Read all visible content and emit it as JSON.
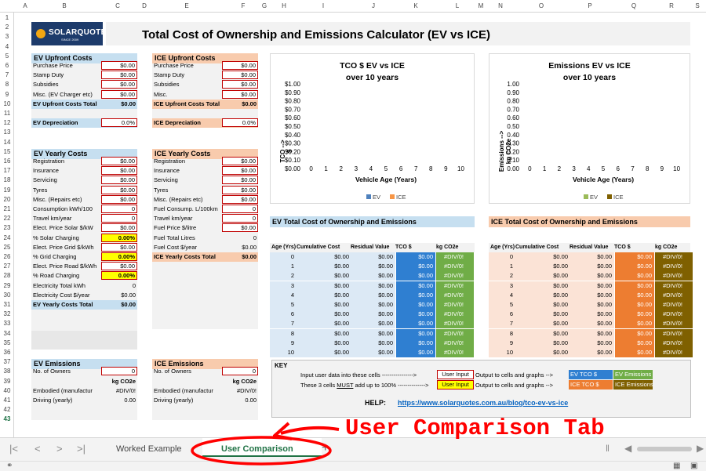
{
  "column_headers": [
    "A",
    "B",
    "C",
    "D",
    "E",
    "F",
    "G",
    "H",
    "I",
    "J",
    "K",
    "L",
    "M",
    "N",
    "O",
    "P",
    "Q",
    "R",
    "S"
  ],
  "row_headers": [
    "1",
    "2",
    "3",
    "4",
    "5",
    "6",
    "7",
    "8",
    "9",
    "10",
    "11",
    "12",
    "13",
    "14",
    "15",
    "16",
    "17",
    "18",
    "19",
    "20",
    "21",
    "22",
    "23",
    "24",
    "25",
    "26",
    "27",
    "28",
    "29",
    "30",
    "31",
    "32",
    "33",
    "34",
    "35",
    "36",
    "37",
    "38",
    "39",
    "40",
    "41",
    "42",
    "43"
  ],
  "logo": {
    "text": "SOLARQUOTES",
    "sub": "SINCE 2009"
  },
  "title": "Total Cost of Ownership and Emissions Calculator (EV vs ICE)",
  "ev_upfront": {
    "header": "EV Upfront Costs",
    "rows": [
      {
        "label": "Purchase Price",
        "value": "$0.00"
      },
      {
        "label": "Stamp Duty",
        "value": "$0.00"
      },
      {
        "label": "Subsidies",
        "value": "$0.00"
      },
      {
        "label": "Misc. (EV Charger etc)",
        "value": "$0.00"
      }
    ],
    "total_label": "EV Upfront Costs Total",
    "total_value": "$0.00",
    "dep_label": "EV Depreciation",
    "dep_value": "0.0%"
  },
  "ice_upfront": {
    "header": "ICE Upfront Costs",
    "rows": [
      {
        "label": "Purchase Price",
        "value": "$0.00"
      },
      {
        "label": "Stamp Duty",
        "value": "$0.00"
      },
      {
        "label": "Subsidies",
        "value": "$0.00"
      },
      {
        "label": "Misc.",
        "value": "$0.00"
      }
    ],
    "total_label": "ICE Upfront Costs Total",
    "total_value": "$0.00",
    "dep_label": "ICE Depreciation",
    "dep_value": "0.0%"
  },
  "ev_yearly": {
    "header": "EV Yearly Costs",
    "rows": [
      {
        "label": "Registration",
        "value": "$0.00",
        "type": "input"
      },
      {
        "label": "Insurance",
        "value": "$0.00",
        "type": "input"
      },
      {
        "label": "Servicing",
        "value": "$0.00",
        "type": "input"
      },
      {
        "label": "Tyres",
        "value": "$0.00",
        "type": "input"
      },
      {
        "label": "Misc. (Repairs etc)",
        "value": "$0.00",
        "type": "input"
      },
      {
        "label": "Consumption kWh/100",
        "value": "0",
        "type": "input"
      },
      {
        "label": "Travel km/year",
        "value": "0",
        "type": "input"
      },
      {
        "label": "Elect. Price Solar $/kW",
        "value": "$0.00",
        "type": "input"
      },
      {
        "label": "% Solar Charging",
        "value": "0.00%",
        "type": "yellow"
      },
      {
        "label": "Elect. Price Grid $/kWh",
        "value": "$0.00",
        "type": "input"
      },
      {
        "label": "% Grid Charging",
        "value": "0.00%",
        "type": "yellow"
      },
      {
        "label": "Elect. Price Road $/kWh",
        "value": "$0.00",
        "type": "input"
      },
      {
        "label": "% Road Charging",
        "value": "0.00%",
        "type": "yellow"
      },
      {
        "label": "Electricity Total kWh",
        "value": "0",
        "type": "plain"
      },
      {
        "label": "Electricity Cost $/year",
        "value": "$0.00",
        "type": "plain"
      }
    ],
    "total_label": "EV Yearly Costs Total",
    "total_value": "$0.00"
  },
  "ice_yearly": {
    "header": "ICE Yearly Costs",
    "rows": [
      {
        "label": "Registration",
        "value": "$0.00",
        "type": "input"
      },
      {
        "label": "Insurance",
        "value": "$0.00",
        "type": "input"
      },
      {
        "label": "Servicing",
        "value": "$0.00",
        "type": "input"
      },
      {
        "label": "Tyres",
        "value": "$0.00",
        "type": "input"
      },
      {
        "label": "Misc. (Repairs etc)",
        "value": "$0.00",
        "type": "input"
      },
      {
        "label": "Fuel Consump. L/100km",
        "value": "0",
        "type": "input"
      },
      {
        "label": "Travel km/year",
        "value": "0",
        "type": "input"
      },
      {
        "label": "Fuel Price $/litre",
        "value": "$0.00",
        "type": "input"
      },
      {
        "label": "Fuel Total Litres",
        "value": "0",
        "type": "plain"
      },
      {
        "label": "Fuel Cost $/year",
        "value": "$0.00",
        "type": "plain"
      }
    ],
    "total_label": "ICE Yearly Costs Total",
    "total_value": "$0.00"
  },
  "ev_emissions": {
    "header": "EV Emissions",
    "owners_label": "No. of Owners",
    "owners_value": "0",
    "unit": "kg CO2e",
    "embodied_label": "Embodied (manufactur",
    "embodied_value": "#DIV/0!",
    "driving_label": "Driving (yearly)",
    "driving_value": "0.00"
  },
  "ice_emissions": {
    "header": "ICE Emissions",
    "owners_label": "No. of Owners",
    "owners_value": "0",
    "unit": "kg CO2e",
    "embodied_label": "Embodied (manufactur",
    "embodied_value": "#DIV/0!",
    "driving_label": "Driving (yearly)",
    "driving_value": "0.00"
  },
  "chart_data": [
    {
      "type": "bar",
      "title": "TCO $ EV vs ICE",
      "subtitle": "over 10 years",
      "xlabel": "Vehicle Age (Years)",
      "ylabel": "TCO -->\n$",
      "categories": [
        "0",
        "1",
        "2",
        "3",
        "4",
        "5",
        "6",
        "7",
        "8",
        "9",
        "10"
      ],
      "y_ticks": [
        "$0.00",
        "$0.10",
        "$0.20",
        "$0.30",
        "$0.40",
        "$0.50",
        "$0.60",
        "$0.70",
        "$0.80",
        "$0.90",
        "$1.00"
      ],
      "ylim": [
        0,
        1
      ],
      "series": [
        {
          "name": "EV",
          "values": [
            0,
            0,
            0,
            0,
            0,
            0,
            0,
            0,
            0,
            0,
            0
          ],
          "color": "#4f81bd"
        },
        {
          "name": "ICE",
          "values": [
            0,
            0,
            0,
            0,
            0,
            0,
            0,
            0,
            0,
            0,
            0
          ],
          "color": "#f79646"
        }
      ],
      "legend": "bottom"
    },
    {
      "type": "bar",
      "title": "Emissions EV vs ICE",
      "subtitle": "over 10 years",
      "xlabel": "Vehicle Age (Years)",
      "ylabel": "Emissions -->\nkg CO2e",
      "categories": [
        "0",
        "1",
        "2",
        "3",
        "4",
        "5",
        "6",
        "7",
        "8",
        "9",
        "10"
      ],
      "y_ticks": [
        "0.00",
        "0.10",
        "0.20",
        "0.30",
        "0.40",
        "0.50",
        "0.60",
        "0.70",
        "0.80",
        "0.90",
        "1.00"
      ],
      "ylim": [
        0,
        1
      ],
      "series": [
        {
          "name": "EV",
          "values": [
            0,
            0,
            0,
            0,
            0,
            0,
            0,
            0,
            0,
            0,
            0
          ],
          "color": "#9bbb59"
        },
        {
          "name": "ICE",
          "values": [
            0,
            0,
            0,
            0,
            0,
            0,
            0,
            0,
            0,
            0,
            0
          ],
          "color": "#7f6000"
        }
      ],
      "legend": "bottom"
    }
  ],
  "ev_table": {
    "title": "EV Total Cost of Ownership and Emissions",
    "headers": [
      "Age (Yrs)",
      "Cumulative Cost",
      "Residual Value",
      "TCO $",
      "kg CO2e"
    ],
    "rows": [
      [
        "0",
        "$0.00",
        "$0.00",
        "$0.00",
        "#DIV/0!"
      ],
      [
        "1",
        "$0.00",
        "$0.00",
        "$0.00",
        "#DIV/0!"
      ],
      [
        "2",
        "$0.00",
        "$0.00",
        "$0.00",
        "#DIV/0!"
      ],
      [
        "3",
        "$0.00",
        "$0.00",
        "$0.00",
        "#DIV/0!"
      ],
      [
        "4",
        "$0.00",
        "$0.00",
        "$0.00",
        "#DIV/0!"
      ],
      [
        "5",
        "$0.00",
        "$0.00",
        "$0.00",
        "#DIV/0!"
      ],
      [
        "6",
        "$0.00",
        "$0.00",
        "$0.00",
        "#DIV/0!"
      ],
      [
        "7",
        "$0.00",
        "$0.00",
        "$0.00",
        "#DIV/0!"
      ],
      [
        "8",
        "$0.00",
        "$0.00",
        "$0.00",
        "#DIV/0!"
      ],
      [
        "9",
        "$0.00",
        "$0.00",
        "$0.00",
        "#DIV/0!"
      ],
      [
        "10",
        "$0.00",
        "$0.00",
        "$0.00",
        "#DIV/0!"
      ]
    ]
  },
  "ice_table": {
    "title": "ICE Total Cost of Ownership and Emissions",
    "headers": [
      "Age (Yrs)",
      "Cumulative Cost",
      "Residual Value",
      "TCO $",
      "kg CO2e"
    ],
    "rows": [
      [
        "0",
        "$0.00",
        "$0.00",
        "$0.00",
        "#DIV/0!"
      ],
      [
        "1",
        "$0.00",
        "$0.00",
        "$0.00",
        "#DIV/0!"
      ],
      [
        "2",
        "$0.00",
        "$0.00",
        "$0.00",
        "#DIV/0!"
      ],
      [
        "3",
        "$0.00",
        "$0.00",
        "$0.00",
        "#DIV/0!"
      ],
      [
        "4",
        "$0.00",
        "$0.00",
        "$0.00",
        "#DIV/0!"
      ],
      [
        "5",
        "$0.00",
        "$0.00",
        "$0.00",
        "#DIV/0!"
      ],
      [
        "6",
        "$0.00",
        "$0.00",
        "$0.00",
        "#DIV/0!"
      ],
      [
        "7",
        "$0.00",
        "$0.00",
        "$0.00",
        "#DIV/0!"
      ],
      [
        "8",
        "$0.00",
        "$0.00",
        "$0.00",
        "#DIV/0!"
      ],
      [
        "9",
        "$0.00",
        "$0.00",
        "$0.00",
        "#DIV/0!"
      ],
      [
        "10",
        "$0.00",
        "$0.00",
        "$0.00",
        "#DIV/0!"
      ]
    ]
  },
  "key": {
    "title": "KEY",
    "line1_left": "Input user data into these cells ---------------->",
    "line1_box": "User Input",
    "line1_right": "Output to cells and graphs -->",
    "line1_out1": "EV TCO $",
    "line1_out2": "EV Emissions",
    "line2_left_a": "These 3 cells ",
    "line2_must": "MUST",
    "line2_left_b": " add up to 100% -------------->",
    "line2_box": "User Input",
    "line2_right": "Output to cells and graphs -->",
    "line2_out1": "ICE TCO $",
    "line2_out2": "ICE Emissions",
    "help_label": "HELP:",
    "help_link": "https://www.solarquotes.com.au/blog/tco-ev-vs-ice"
  },
  "tabs": {
    "sheet1": "Worked Example",
    "sheet2": "User Comparison",
    "add": "+"
  },
  "annotation": "User Comparison Tab"
}
